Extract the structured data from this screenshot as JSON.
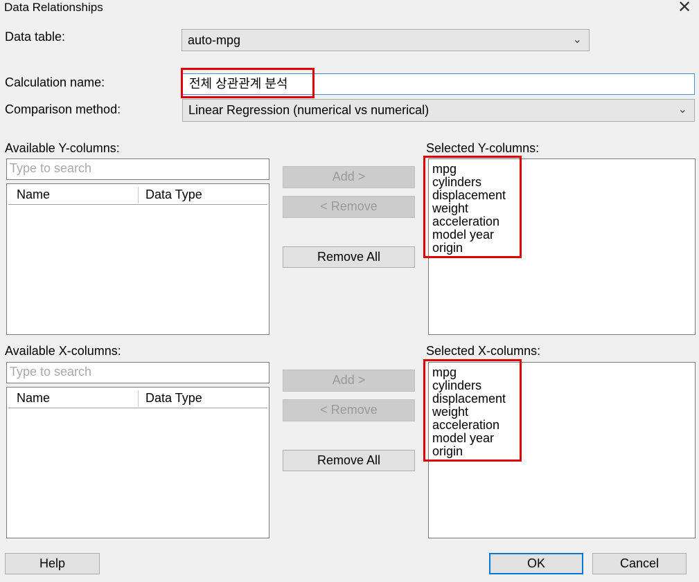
{
  "window": {
    "title": "Data Relationships",
    "close_glyph": "✕"
  },
  "data_table": {
    "label": "Data table:",
    "value": "auto-mpg"
  },
  "calculation_name": {
    "label": "Calculation name:",
    "value": "전체 상관관계 분석"
  },
  "comparison_method": {
    "label": "Comparison method:",
    "value": "Linear Regression (numerical vs numerical)"
  },
  "y_panel": {
    "available_label": "Available Y-columns:",
    "search_placeholder": "Type to search",
    "col_name": "Name",
    "col_type": "Data Type",
    "add_label": "Add >",
    "remove_label": "< Remove",
    "remove_all_label": "Remove All",
    "selected_label": "Selected Y-columns:",
    "selected": [
      "mpg",
      "cylinders",
      "displacement",
      "weight",
      "acceleration",
      "model year",
      "origin"
    ]
  },
  "x_panel": {
    "available_label": "Available X-columns:",
    "search_placeholder": "Type to search",
    "col_name": "Name",
    "col_type": "Data Type",
    "add_label": "Add >",
    "remove_label": "< Remove",
    "remove_all_label": "Remove All",
    "selected_label": "Selected X-columns:",
    "selected": [
      "mpg",
      "cylinders",
      "displacement",
      "weight",
      "acceleration",
      "model year",
      "origin"
    ]
  },
  "footer": {
    "help_label": "Help",
    "ok_label": "OK",
    "cancel_label": "Cancel"
  },
  "colors": {
    "highlight": "#e00000",
    "focus": "#0078d7",
    "background": "#f0f0f0"
  }
}
